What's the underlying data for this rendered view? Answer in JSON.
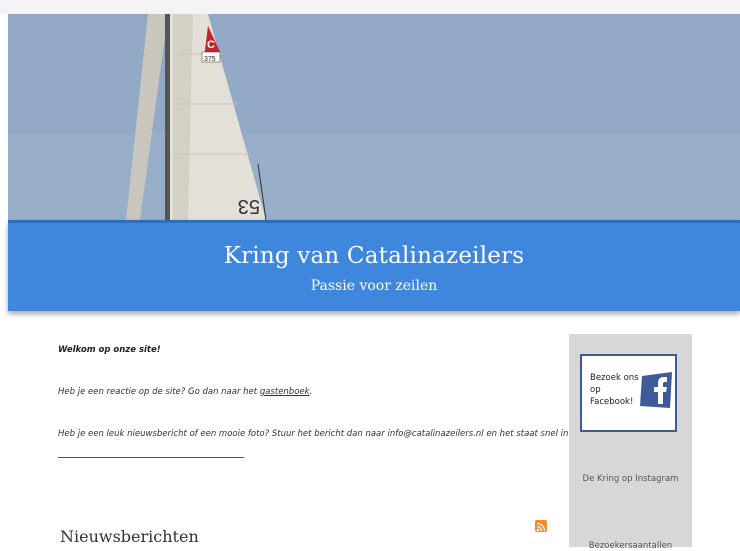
{
  "site": {
    "title": "Kring van Catalinazeilers",
    "tagline": "Passie voor zeilen"
  },
  "hero": {
    "sail_numbers": "53",
    "sail_class_letter": "C",
    "sail_class_number": "375"
  },
  "main": {
    "welcome": "Welkom op onze site!",
    "reaction_prefix": "Heb je een reactie op de site? Go dan naar het ",
    "reaction_link": "gastenboek",
    "reaction_suffix": ".",
    "news_text": "Heb je een leuk nieuwsbericht of een mooie foto? Stuur het bericht dan naar info@catalinazeilers.nl en het staat snel in het overzicht!",
    "news_heading": "Nieuwsberichten"
  },
  "sidebar": {
    "facebook": {
      "line1": "Bezoek ons",
      "line2": "op",
      "line3": "Facebook!"
    },
    "instagram_link": "De Kring op Instagram",
    "visitors_link": "Bezoekersaantallen"
  },
  "colors": {
    "banner": "#3f87dc",
    "facebook": "#3d5a99",
    "rss": "#f18b2d"
  }
}
